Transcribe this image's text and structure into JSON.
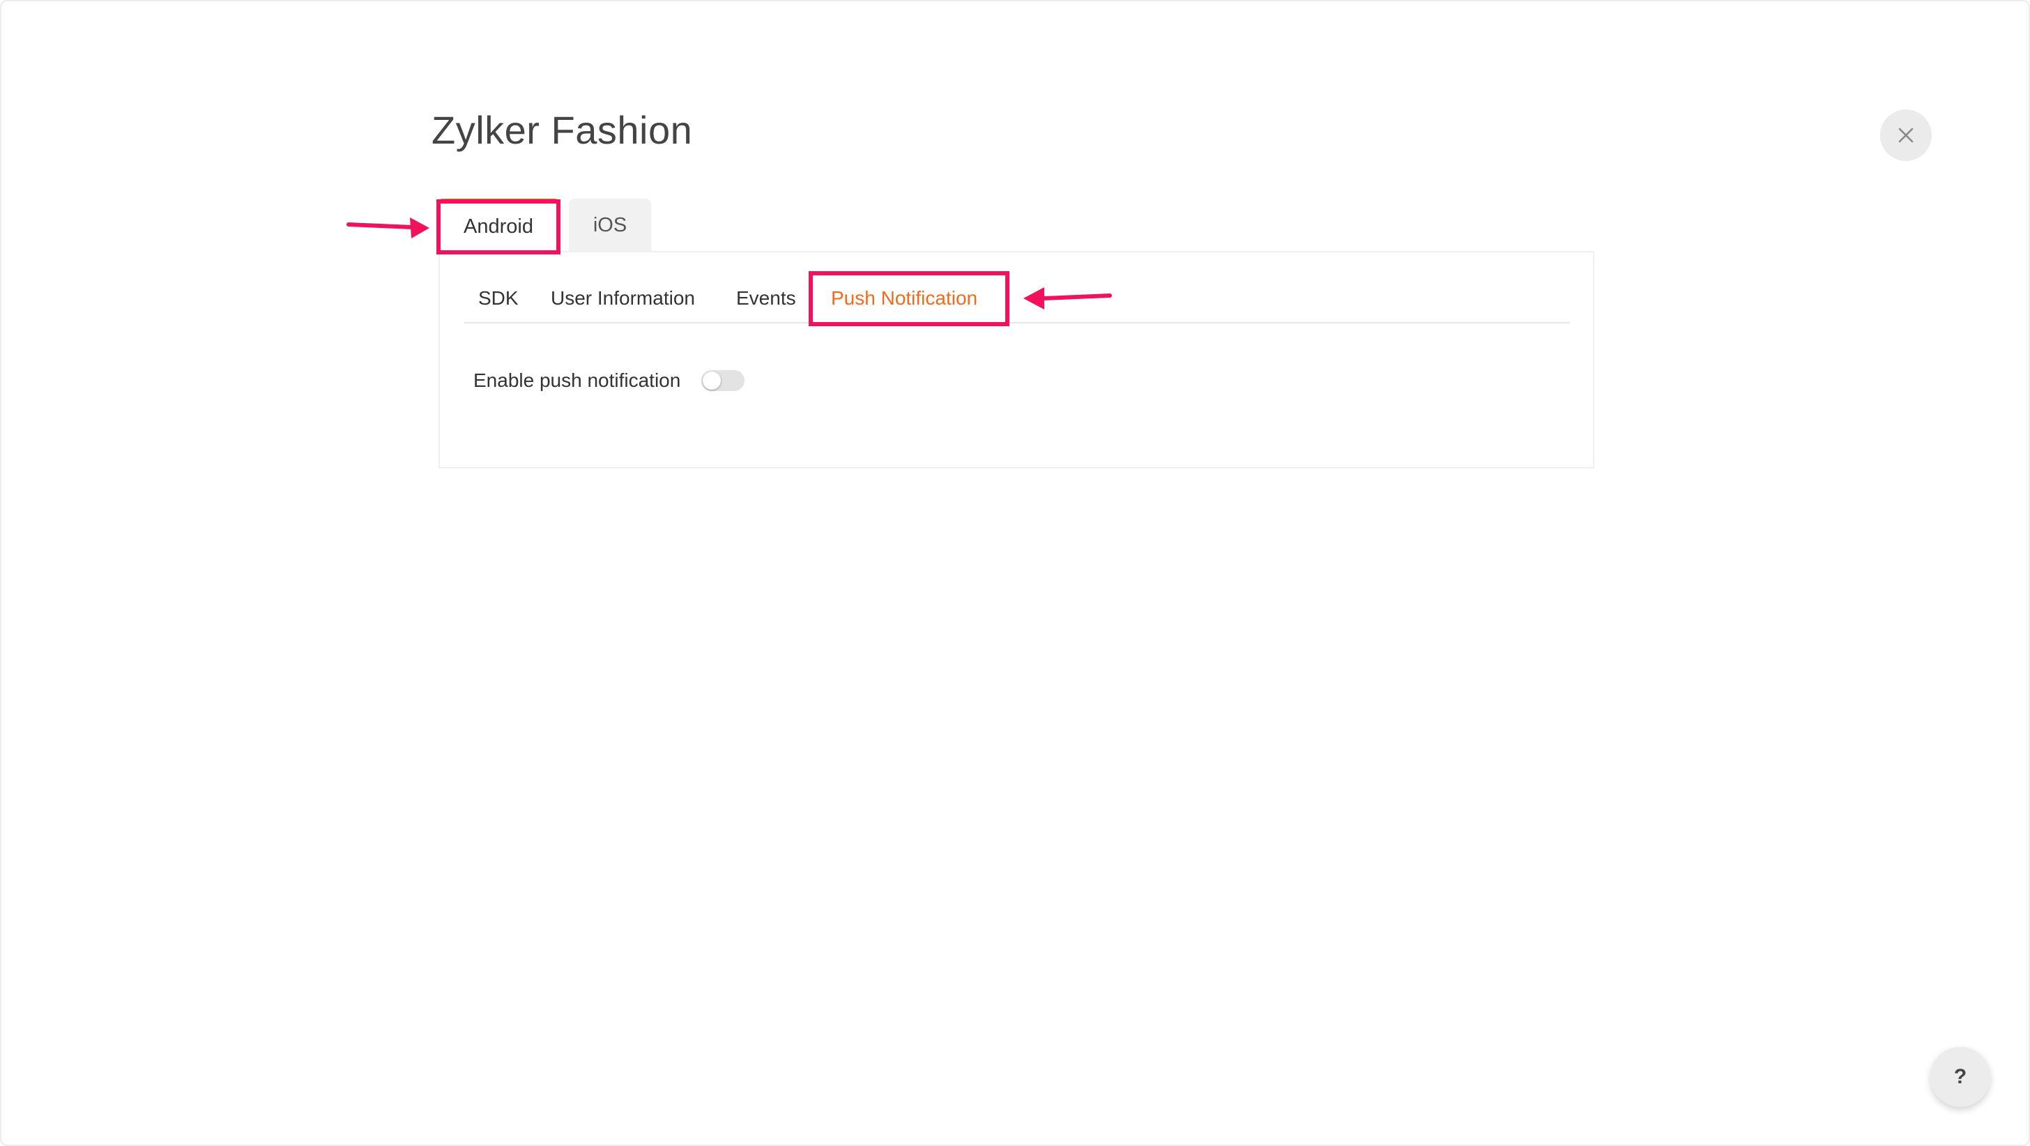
{
  "dialog": {
    "title": "Zylker Fashion",
    "close_icon": "close-icon"
  },
  "platform_tabs": [
    {
      "label": "Android",
      "active": true
    },
    {
      "label": "iOS",
      "active": false
    }
  ],
  "sub_tabs": [
    {
      "label": "SDK",
      "active": false
    },
    {
      "label": "User Information",
      "active": false
    },
    {
      "label": "Events",
      "active": false
    },
    {
      "label": "Push Notification",
      "active": true
    }
  ],
  "settings": {
    "push_label": "Enable push notification",
    "push_enabled": false
  },
  "help": {
    "label": "?"
  },
  "colors": {
    "accent": "#f26b1d",
    "annotation": "#f2125c",
    "toggle_off": "#e3e3e3"
  }
}
